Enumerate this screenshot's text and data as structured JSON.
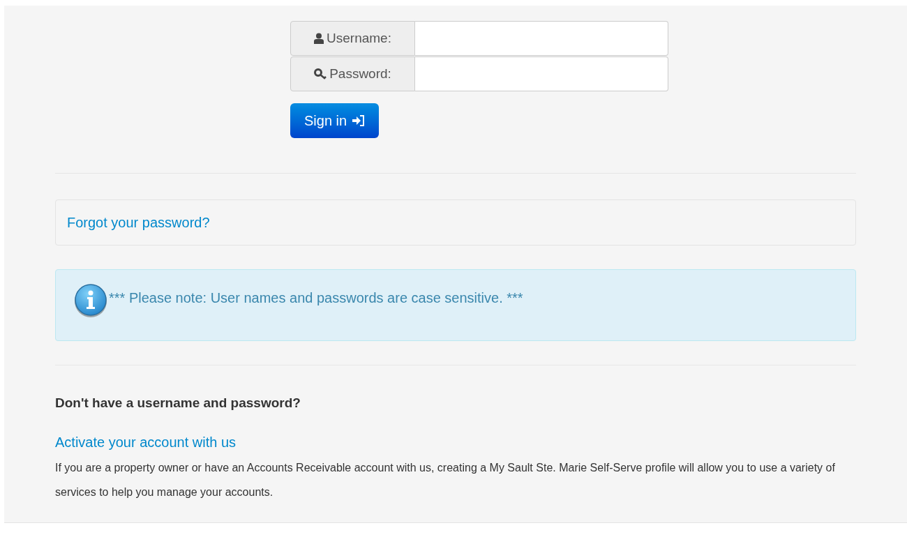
{
  "login": {
    "fields": [
      {
        "kind": "user",
        "label": "Username:"
      },
      {
        "kind": "key",
        "label": "Password:"
      }
    ],
    "button": "Sign in"
  },
  "forgot_link": "Forgot your password?",
  "notice": "*** Please note: User names and passwords are case sensitive. ***",
  "signup": {
    "heading": "Don't have a username and password?",
    "link": "Activate your account with us",
    "text": "If you are a property owner or have an Accounts Receivable account with us, creating a My Sault Ste. Marie Self-Serve profile will allow you to use a variety of services to help you manage your accounts."
  }
}
